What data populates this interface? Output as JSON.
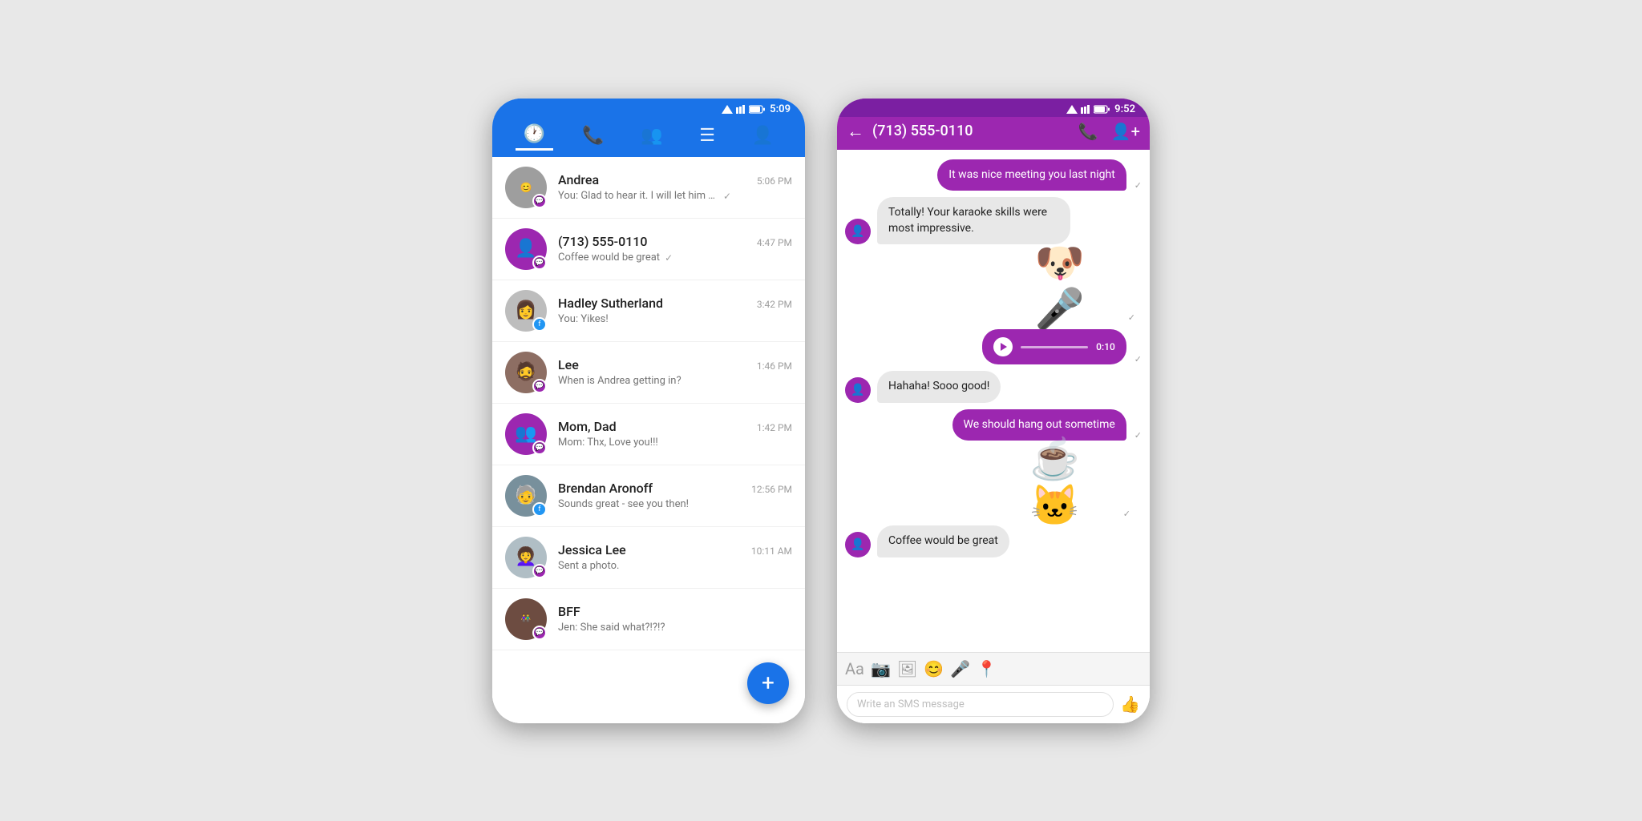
{
  "phone1": {
    "status": {
      "time": "5:09"
    },
    "nav": {
      "tabs": [
        "🕐",
        "📞",
        "👥",
        "☰",
        "👤"
      ]
    },
    "conversations": [
      {
        "name": "Andrea",
        "time": "5:06 PM",
        "preview": "You: Glad to hear it. I will let him know..",
        "badge": "purple",
        "avatarType": "image",
        "avatarColor": "#9e9e9e"
      },
      {
        "name": "(713) 555-0110",
        "time": "4:47 PM",
        "preview": "Coffee would be great",
        "badge": "purple",
        "avatarType": "icon",
        "avatarColor": "#9c27b0"
      },
      {
        "name": "Hadley Sutherland",
        "time": "3:42 PM",
        "preview": "You: Yikes!",
        "badge": "blue",
        "avatarType": "image",
        "avatarColor": "#9e9e9e"
      },
      {
        "name": "Lee",
        "time": "1:46 PM",
        "preview": "When is Andrea getting in?",
        "badge": "purple",
        "avatarType": "image",
        "avatarColor": "#9e9e9e"
      },
      {
        "name": "Mom, Dad",
        "time": "1:42 PM",
        "preview": "Mom: Thx, Love you!!!",
        "badge": "purple",
        "avatarType": "group",
        "avatarColor": "#9c27b0"
      },
      {
        "name": "Brendan Aronoff",
        "time": "12:56 PM",
        "preview": "Sounds great - see you then!",
        "badge": "blue",
        "avatarType": "image",
        "avatarColor": "#9e9e9e"
      },
      {
        "name": "Jessica Lee",
        "time": "10:11 AM",
        "preview": "Sent a photo.",
        "badge": "purple",
        "avatarType": "image",
        "avatarColor": "#9e9e9e"
      },
      {
        "name": "BFF",
        "time": "",
        "preview": "Jen: She said what?!?!?",
        "badge": "purple",
        "avatarType": "image",
        "avatarColor": "#9e9e9e"
      }
    ],
    "fab": "+"
  },
  "phone2": {
    "status": {
      "time": "9:52"
    },
    "header": {
      "title": "(713) 555-0110",
      "back": "←"
    },
    "messages": [
      {
        "type": "sent",
        "text": "It was nice meeting you last night",
        "showCheck": true
      },
      {
        "type": "received",
        "text": "Totally! Your karaoke skills were most impressive.",
        "showAvatar": true
      },
      {
        "type": "sticker-sent",
        "emoji": "🎤🐶"
      },
      {
        "type": "voice-sent",
        "duration": "0:10",
        "showCheck": true
      },
      {
        "type": "received",
        "text": "Hahaha! Sooo good!",
        "showAvatar": true
      },
      {
        "type": "sent",
        "text": "We should hang out sometime",
        "showCheck": true
      },
      {
        "type": "sticker-sent",
        "emoji": "☕🐱"
      },
      {
        "type": "received",
        "text": "Coffee would be great",
        "showAvatar": true
      }
    ],
    "input": {
      "placeholder": "Write an SMS message",
      "icons": [
        "Aa",
        "📷",
        "🖼",
        "😊",
        "🎤",
        "📍"
      ]
    },
    "bottomIcons": [
      "Aa",
      "📷",
      "🖼",
      "😊",
      "🎤",
      "📍"
    ]
  }
}
